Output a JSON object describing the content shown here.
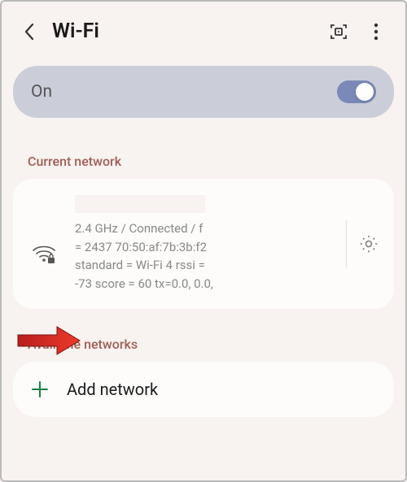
{
  "header": {
    "title": "Wi-Fi"
  },
  "toggle": {
    "label": "On"
  },
  "sections": {
    "current_label": "Current network",
    "available_label": "Available networks"
  },
  "current_network": {
    "details_line1": "2.4 GHz / Connected / f",
    "details_line2": "= 2437 70:50:af:7b:3b:f2",
    "details_line3": "standard = Wi-Fi 4 rssi =",
    "details_line4": "-73 score = 60  tx=0.0, 0.0,"
  },
  "add": {
    "label": "Add network"
  }
}
